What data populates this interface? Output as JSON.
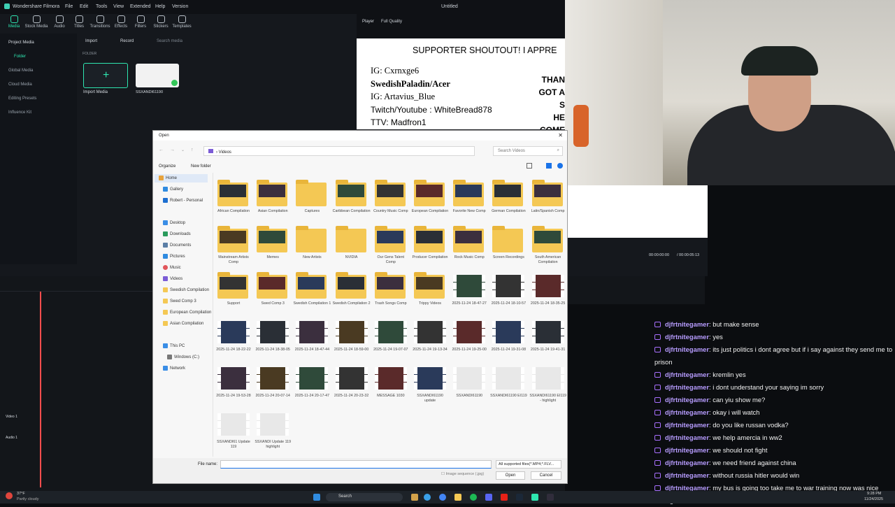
{
  "filmora": {
    "app_title": "Wondershare Filmora",
    "menu": [
      "File",
      "Edit",
      "Tools",
      "View",
      "Extended",
      "Help",
      "Version"
    ],
    "project_title": "Untitled",
    "toolbar": [
      "Media",
      "Stock Media",
      "Audio",
      "Titles",
      "Transitions",
      "Effects",
      "Filters",
      "Stickers",
      "Templates"
    ],
    "side": [
      "Project Media",
      "Folder",
      "Global Media",
      "Cloud Media",
      "Editing Presets",
      "Influence Kit"
    ],
    "media_bar": {
      "import": "Import",
      "record": "Record",
      "search_placeholder": "Search media"
    },
    "folder_label": "FOLDER",
    "import_media_label": "Import Media",
    "clip_label": "SSXANDI61190",
    "player_label": "Player",
    "quality": "Full Quality",
    "timecode": "00:00:00:00",
    "timecode_total": "/ 00:00:05:13",
    "preview": {
      "headline": "SUPPORTER SHOUTOUT! I APPRE",
      "lines": [
        "IG: Cxrnxge6",
        "SwedishPaladin/Acer",
        "IG: Artavius_Blue",
        "Twitch/Youtube : WhiteBread878",
        "TTV: Madfron1"
      ],
      "right": [
        "THAN",
        "GOT A S",
        "HE",
        "COME"
      ]
    },
    "tracks": [
      "Video 1",
      "Audio 1"
    ]
  },
  "dialog": {
    "title": "Open",
    "path": "Videos",
    "search_placeholder": "Search Videos",
    "organize": "Organize",
    "new_folder": "New folder",
    "nav": [
      "Home",
      "Gallery",
      "Robert - Personal",
      "Desktop",
      "Downloads",
      "Documents",
      "Pictures",
      "Music",
      "Videos",
      "Swedish Compilation",
      "Swed Comp 3",
      "European Compilation",
      "Asian Compilation",
      "This PC",
      "Windows (C:)",
      "Network"
    ],
    "items": [
      {
        "label": "African Compilation",
        "kind": "folder"
      },
      {
        "label": "Asian Compilation",
        "kind": "folder"
      },
      {
        "label": "Captures",
        "kind": "folder"
      },
      {
        "label": "Caribbean Compilation",
        "kind": "folder"
      },
      {
        "label": "Country Music Comp",
        "kind": "folder"
      },
      {
        "label": "European Compilation",
        "kind": "folder"
      },
      {
        "label": "Favorite New Comp",
        "kind": "folder"
      },
      {
        "label": "German Compilation",
        "kind": "folder"
      },
      {
        "label": "Latin/Spanish Comp",
        "kind": "folder"
      },
      {
        "label": "Mainstream Artists Comp",
        "kind": "folder"
      },
      {
        "label": "Memes",
        "kind": "folder"
      },
      {
        "label": "New Artists",
        "kind": "folder"
      },
      {
        "label": "NVIDIA",
        "kind": "folder"
      },
      {
        "label": "Our Gens Talent Comp",
        "kind": "folder"
      },
      {
        "label": "Producer Compilation",
        "kind": "folder"
      },
      {
        "label": "Rock Music Comp",
        "kind": "folder"
      },
      {
        "label": "Screen Recordings",
        "kind": "folder"
      },
      {
        "label": "South American Compilation",
        "kind": "folder"
      },
      {
        "label": "Support",
        "kind": "folder"
      },
      {
        "label": "Swed Comp 3",
        "kind": "folder"
      },
      {
        "label": "Swedish Compilation 1",
        "kind": "folder"
      },
      {
        "label": "Swedish Compilation 2",
        "kind": "folder"
      },
      {
        "label": "Trash Songs Comp",
        "kind": "folder"
      },
      {
        "label": "Trippy Videos",
        "kind": "folder"
      },
      {
        "label": "2025-11-24 18-47-27",
        "kind": "video"
      },
      {
        "label": "2025-11-24 18-10-57",
        "kind": "video"
      },
      {
        "label": "2025-11-24 18-35-25",
        "kind": "video"
      },
      {
        "label": "2025-11-24 18-22-22",
        "kind": "video"
      },
      {
        "label": "2025-11-24 18-38-05",
        "kind": "video"
      },
      {
        "label": "2025-11-24 18-47-44",
        "kind": "video"
      },
      {
        "label": "2025-11-24 18-59-00",
        "kind": "video"
      },
      {
        "label": "2025-11-24 19-07-07",
        "kind": "video"
      },
      {
        "label": "2025-11-24 19-13-34",
        "kind": "video"
      },
      {
        "label": "2025-11-24 19-25-00",
        "kind": "video"
      },
      {
        "label": "2025-11-24 19-31-08",
        "kind": "video"
      },
      {
        "label": "2025-11-24 19-41-31",
        "kind": "video"
      },
      {
        "label": "2025-11-24 19-53-28",
        "kind": "video"
      },
      {
        "label": "2025-11-24 20-07-14",
        "kind": "video"
      },
      {
        "label": "2025-11-24 20-17-47",
        "kind": "video"
      },
      {
        "label": "2025-11-24 20-23-32",
        "kind": "video"
      },
      {
        "label": "MESSAGE 1030",
        "kind": "video"
      },
      {
        "label": "SSXANDI61190 update",
        "kind": "video"
      },
      {
        "label": "SSXANDI61190",
        "kind": "video"
      },
      {
        "label": "SSXANDI61190 EI119",
        "kind": "video"
      },
      {
        "label": "SSXANDI61190 EI119 - highlight",
        "kind": "video"
      },
      {
        "label": "SSXANDI61 Update 119",
        "kind": "video"
      },
      {
        "label": "SSXANDI Update 119 highlight",
        "kind": "video"
      }
    ],
    "file_name_label": "File name:",
    "file_type": "All supported files(*.MP4;*.FLV...",
    "image_sequence": "Image sequence (.jpg)",
    "open": "Open",
    "cancel": "Cancel"
  },
  "chat": [
    {
      "user": "djfrtnitegamer",
      "text": "but make sense"
    },
    {
      "user": "djfrtnitegamer",
      "text": "yes"
    },
    {
      "user": "djfrtnitegamer",
      "text": "its just politics i dont agree but if i say against they send me to prison"
    },
    {
      "user": "djfrtnitegamer",
      "text": "kremlin yes"
    },
    {
      "user": "djfrtnitegamer",
      "text": "i dont understand your saying im sorry"
    },
    {
      "user": "djfrtnitegamer",
      "text": "can yiu show me?"
    },
    {
      "user": "djfrtnitegamer",
      "text": "okay i will watch"
    },
    {
      "user": "djfrtnitegamer",
      "text": "do you like russan vodka?"
    },
    {
      "user": "djfrtnitegamer",
      "text": "we help amercia in ww2"
    },
    {
      "user": "djfrtnitegamer",
      "text": "we should not fight"
    },
    {
      "user": "djfrtnitegamer",
      "text": "we need friend against china"
    },
    {
      "user": "djfrtnitegamer",
      "text": "without russia hitler would win"
    },
    {
      "user": "djfrtnitegamer",
      "text": "my bus is going too take me to war training now was nice talking"
    }
  ],
  "taskbar": {
    "weather_temp": "37°F",
    "weather_desc": "Partly cloudy",
    "search": "Search",
    "time": "9:28 PM",
    "date": "11/24/2025"
  }
}
